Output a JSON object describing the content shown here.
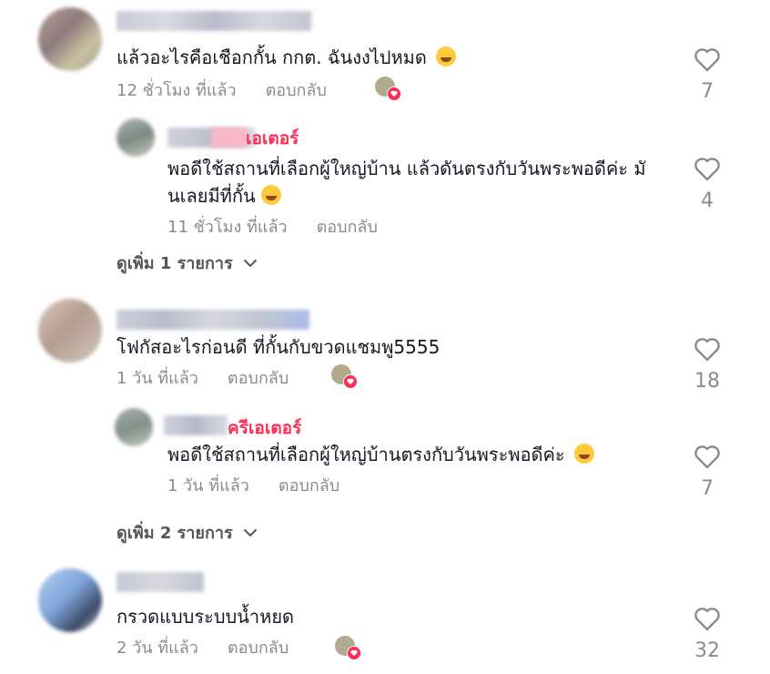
{
  "colors": {
    "creator": "#fe2c55",
    "meta": "#8a8b91",
    "text": "#161823"
  },
  "comments": [
    {
      "text": "แล้วอะไรคือเชือกกั้น กกต. ฉันงงไปหมด",
      "emoji": "rolling-on-floor-laughing",
      "time": "12 ชั่วโมง ที่แล้ว",
      "reply_label": "ตอบกลับ",
      "likes": "7",
      "reply": {
        "badge": "เอเตอร์",
        "text_line1": "พอดีใช้สถานที่เลือกผู้ใหญ่บ้าน แล้วดันตรงกับวันพระพอดีค่ะ มั",
        "text_line2": "นเลยมีที่กั้น",
        "emoji": "sweat-smile",
        "time": "11 ชั่วโมง ที่แล้ว",
        "reply_label": "ตอบกลับ",
        "likes": "4"
      },
      "more_label": "ดูเพิ่ม 1 รายการ"
    },
    {
      "text": "โฟกัสอะไรก่อนดี ที่กั้นกับขวดแชมพู5555",
      "time": "1 วัน ที่แล้ว",
      "reply_label": "ตอบกลับ",
      "likes": "18",
      "reply": {
        "badge": "ครีเอเตอร์",
        "text_line1": "พอดีใช้สถานที่เลือกผู้ใหญ่บ้านตรงกับวันพระพอดีค่ะ",
        "emoji": "sweat-smile",
        "time": "1 วัน ที่แล้ว",
        "reply_label": "ตอบกลับ",
        "likes": "7"
      },
      "more_label": "ดูเพิ่ม 2 รายการ"
    },
    {
      "text": "กรวดแบบระบบน้ำหยด",
      "time": "2 วัน ที่แล้ว",
      "reply_label": "ตอบกลับ",
      "likes": "32"
    }
  ]
}
